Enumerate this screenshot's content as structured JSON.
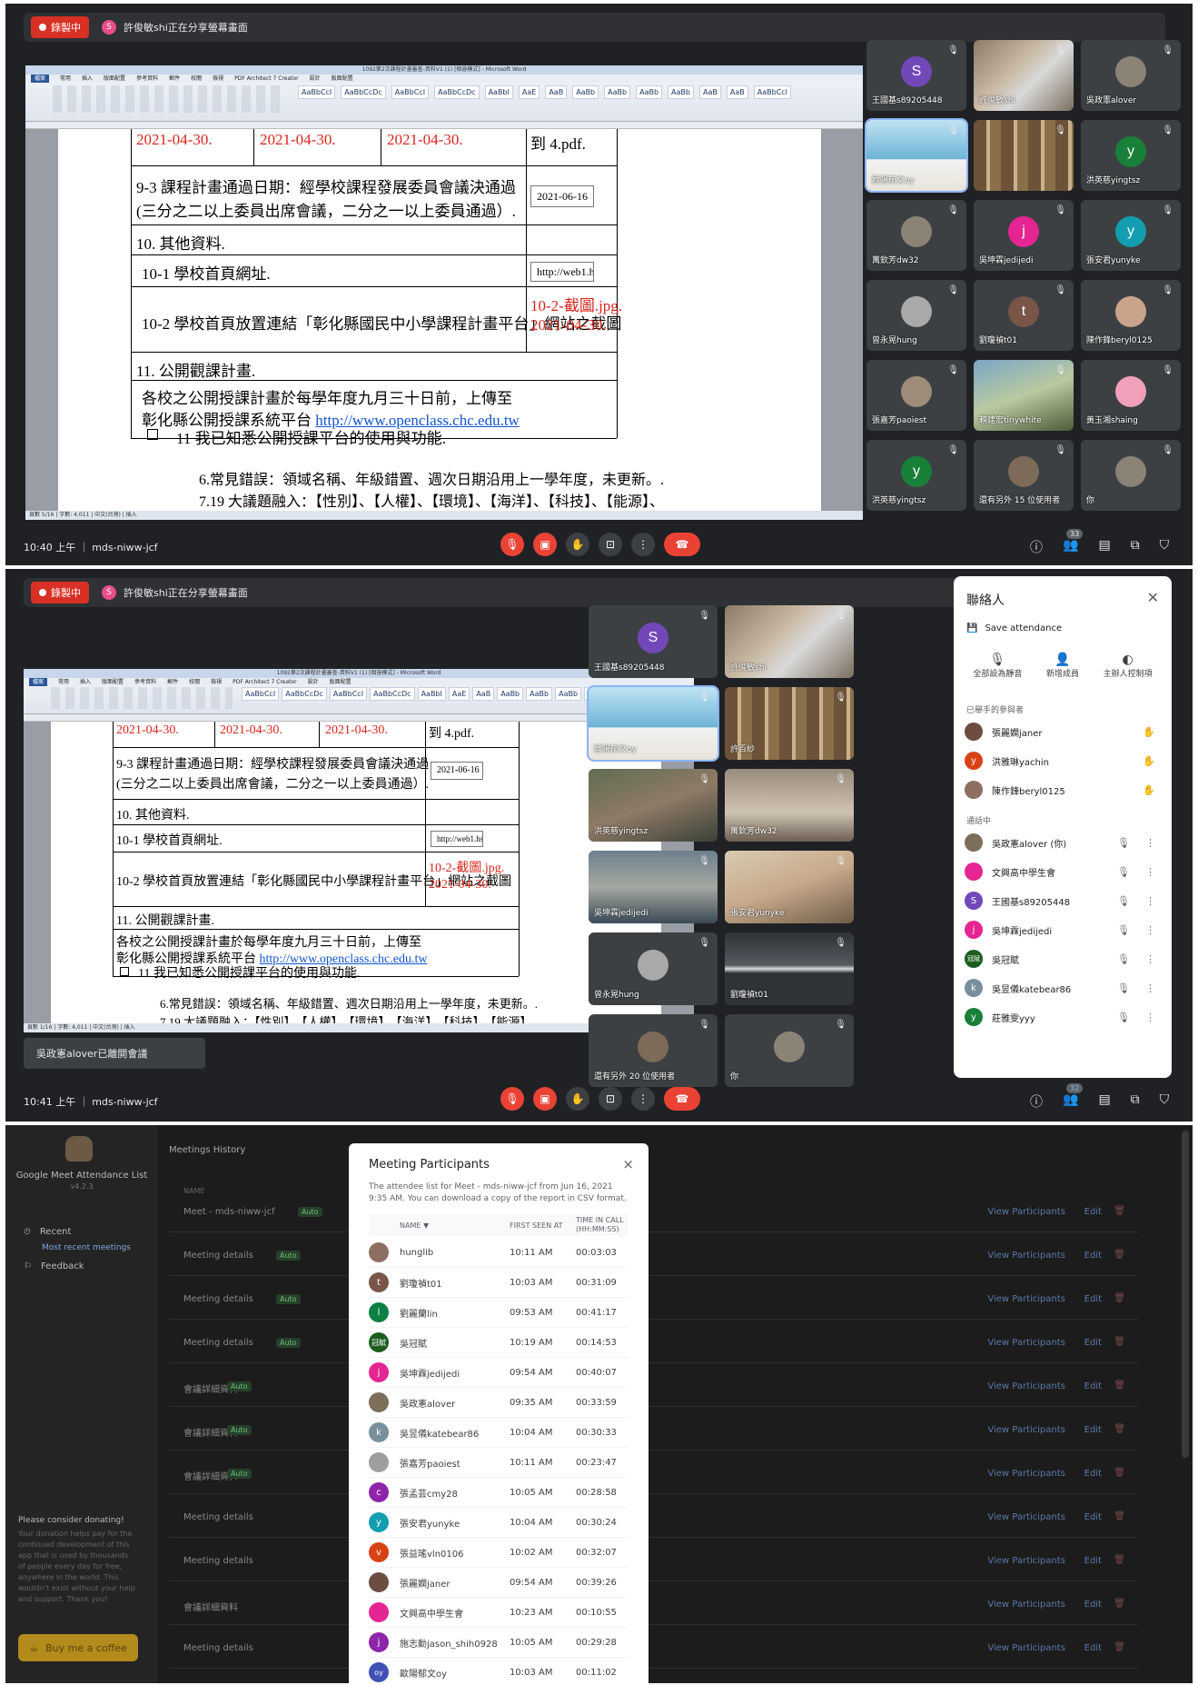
{
  "recording_label": "錄製中",
  "share_initial": "S",
  "share_text": "許俊敏shi正在分享螢幕畫面",
  "doc": {
    "title": "1092第2次課程計畫審查-資料V1 (1) [相容模式] - Microsoft Word",
    "tabs": [
      "檔案",
      "常用",
      "插入",
      "版面配置",
      "參考資料",
      "郵件",
      "校閱",
      "檢視",
      "PDF Architect 7 Creator",
      "設計",
      "版面配置"
    ],
    "styles": [
      "AaBbCcI",
      "AaBbCcDc",
      "AaBbCcI",
      "AaBbCcDc",
      "AaBbI",
      "AaE",
      "AaB",
      "AaBb",
      "AaBb",
      "AaBb",
      "AaBb",
      "AaB",
      "AaB",
      "AaBbCcI"
    ],
    "date1": "2021-04-30.",
    "date2": "2021-04-30.",
    "date3": "2021-04-30.",
    "to_pdf": "到 4.pdf.",
    "row93_line1": "9-3 課程計畫通過日期：經學校課程發展委員會議決通過",
    "row93_line2": "(三分之二以上委員出席會議，二分之一以上委員通過）.",
    "row93_value": "2021-06-16",
    "row10": "10. 其他資料.",
    "row101": "10-1 學校首頁網址.",
    "row101_value": "http://web1.hs",
    "row102": "10-2 學校首頁放置連結「彰化縣國民中小學課程計畫平台」網站之截圖",
    "row102_value1": "10-2-截圖.jpg.",
    "row102_value2": "2021-04-30.",
    "row11": "11. 公開觀課計畫.",
    "row11_line1": "各校之公開授課計畫於每學年度九月三十日前，上傳至",
    "row11_line2_prefix": "彰化縣公開授課系統平台 ",
    "row11_link": "http://www.openclass.chc.edu.tw",
    "row11_check": "11 我已知悉公開授課平台的使用與功能.",
    "note6": "6.常見錯誤：領域名稱、年級錯置、週次日期沿用上一學年度，未更新。.",
    "note7": "7.19 大議題融入：【性別】、【人權】、【環境】、【海洋】、【科技】、【能源】、",
    "status1": "頁數 5/16 | 字數: 4,011 | 中文(台灣) | 插入",
    "status2": "頁數 1/16 | 字數: 4,011 | 中文(台灣) | 插入"
  },
  "panel1": {
    "tiles": [
      {
        "name": "王國基s89205448",
        "initial": "S",
        "color": "#7248b9"
      },
      {
        "name": "許俊敏shi",
        "photo": "man-with-mask"
      },
      {
        "name": "吳政憲alover",
        "photo": "avatar-grey"
      },
      {
        "name": "歐陽郁文oy",
        "photo": "seaside"
      },
      {
        "name": "",
        "photo": "bookshelf"
      },
      {
        "name": "洪英慈yingtsz",
        "initial": "y",
        "color": "#188038"
      },
      {
        "name": "萬欽芳dw32",
        "photo": "avatar-grey"
      },
      {
        "name": "吳坤霖jedijedi",
        "initial": "j",
        "color": "#e52592"
      },
      {
        "name": "張安君yunyke",
        "initial": "y",
        "color": "#129eaf"
      },
      {
        "name": "曾永晃hung",
        "photo": "avatar-sunglasses"
      },
      {
        "name": "劉瓊禎t01",
        "initial": "t",
        "color": "#795548"
      },
      {
        "name": "陳作鋒beryl0125",
        "photo": "avatar-baby"
      },
      {
        "name": "張嘉芳paoiest",
        "photo": "avatar-dog"
      },
      {
        "name": "賴建宏tinywhite",
        "photo": "man-outdoor"
      },
      {
        "name": "黃玉湘shaing",
        "photo": "avatar-girl"
      },
      {
        "name": "洪英慈yingtsz",
        "initial": "y",
        "color": "#188038"
      },
      {
        "name": "還有另外 15 位使用者",
        "photo": "group"
      },
      {
        "name": "你",
        "photo": "avatar-grey"
      }
    ],
    "clock": "10:40 上午 ｜ mds-niww-jcf",
    "people_count": "33"
  },
  "panel2": {
    "tiles": [
      {
        "name": "王國基s89205448",
        "initial": "S",
        "color": "#7248b9"
      },
      {
        "name": "許俊敏shi",
        "photo": "man-with-mask"
      },
      {
        "name": "歐陽郁文oy",
        "photo": "seaside"
      },
      {
        "name": "許百紗",
        "photo": "bookshelf"
      },
      {
        "name": "洪英慈yingtsz",
        "photo": "woman-mask"
      },
      {
        "name": "萬欽芳dw32",
        "photo": "man-door"
      },
      {
        "name": "吳坤霖jedijedi",
        "photo": "man-office"
      },
      {
        "name": "張安君yunyke",
        "photo": "woman-glasses"
      },
      {
        "name": "曾永晃hung",
        "photo": "avatar-sunglasses"
      },
      {
        "name": "劉瓊禎t01",
        "photo": "light"
      },
      {
        "name": "還有另外 20 位使用者",
        "photo": "group"
      },
      {
        "name": "你",
        "photo": "avatar-grey"
      }
    ],
    "toast": "吳政憲alover已離開會議",
    "clock": "10:41 上午 ｜ mds-niww-jcf",
    "people_count": "32",
    "people_panel": {
      "title": "聯絡人",
      "save": "Save attendance",
      "actions": [
        "全部設為靜音",
        "新增成員",
        "主辦人控制項"
      ],
      "raised_header": "已舉手的參與者",
      "raised": [
        {
          "name": "張麗嫻janer",
          "color": "#6d4c41",
          "initial": ""
        },
        {
          "name": "洪雅琳yachin",
          "color": "#d84315",
          "initial": "y"
        },
        {
          "name": "陳作鋒beryl0125",
          "color": "#8d6e63",
          "initial": ""
        }
      ],
      "in_call_header": "通話中",
      "in_call": [
        {
          "name": "吳政憲alover (你)",
          "color": "#7b6f5a",
          "initial": ""
        },
        {
          "name": "文興高中學生會",
          "color": "#e52592",
          "initial": ""
        },
        {
          "name": "王國基s89205448",
          "color": "#7248b9",
          "initial": "S"
        },
        {
          "name": "吳坤霖jedijedi",
          "color": "#e52592",
          "initial": "j"
        },
        {
          "name": "吳冠賦",
          "color": "#1b5e20",
          "initial": "冠賦"
        },
        {
          "name": "吳昱儀katebear86",
          "color": "#78909c",
          "initial": "k"
        },
        {
          "name": "莊雅雯yyy",
          "color": "#188038",
          "initial": "y"
        }
      ]
    }
  },
  "panel3": {
    "app_title": "Google Meet Attendance List",
    "version": "v4.2.3",
    "recent": "Recent",
    "most_recent": "Most recent meetings",
    "feedback": "Feedback",
    "donate_title": "Please consider donating!",
    "donate_text": "Your donation helps pay for the continued development of this app that is used by thousands of people every day for free, anywhere in the world. This wouldn't exist without your help and support. Thank you!",
    "coffee": "Buy me a coffee",
    "history_title": "Meetings History",
    "name_header": "NAME",
    "meetings": [
      {
        "name": "Meet - mds-niww-jcf",
        "tag": "Auto"
      },
      {
        "name": "Meeting details",
        "tag": "Auto"
      },
      {
        "name": "Meeting details",
        "tag": "Auto"
      },
      {
        "name": "Meeting details",
        "tag": "Auto"
      },
      {
        "name": "會議詳細資料",
        "tag": "Auto"
      },
      {
        "name": "會議詳細資料",
        "tag": "Auto"
      },
      {
        "name": "會議詳細資料",
        "tag": "Auto"
      },
      {
        "name": "Meeting details",
        "tag": ""
      },
      {
        "name": "Meeting details",
        "tag": ""
      },
      {
        "name": "會議詳細資料",
        "tag": ""
      },
      {
        "name": "Meeting details",
        "tag": ""
      }
    ],
    "view_label": "View Participants",
    "edit_label": "Edit",
    "modal": {
      "title": "Meeting Participants",
      "close": "×",
      "desc": "The attendee list for Meet - mds-niww-jcf from Jun 16, 2021 9:35 AM. You can download a copy of the report in CSV format.",
      "col1": "NAME ▼",
      "col2": "FIRST SEEN AT",
      "col3": "TIME IN CALL (HH:MM:SS)",
      "rows": [
        {
          "name": "hunglib",
          "seen": "10:11 AM",
          "time": "00:03:03",
          "initial": "",
          "color": "#8d6e63"
        },
        {
          "name": "劉瓊禎t01",
          "seen": "10:03 AM",
          "time": "00:31:09",
          "initial": "t",
          "color": "#795548"
        },
        {
          "name": "劉麗蘭lin",
          "seen": "09:53 AM",
          "time": "00:41:17",
          "initial": "l",
          "color": "#0b8043"
        },
        {
          "name": "吳冠賦",
          "seen": "10:19 AM",
          "time": "00:14:53",
          "initial": "冠賦",
          "color": "#1b5e20"
        },
        {
          "name": "吳坤霖jedijedi",
          "seen": "09:54 AM",
          "time": "00:40:07",
          "initial": "j",
          "color": "#e52592"
        },
        {
          "name": "吳政憲alover",
          "seen": "09:35 AM",
          "time": "00:33:59",
          "initial": "",
          "color": "#7b6f5a"
        },
        {
          "name": "吳昱儀katebear86",
          "seen": "10:04 AM",
          "time": "00:30:33",
          "initial": "k",
          "color": "#78909c"
        },
        {
          "name": "張嘉芳paoiest",
          "seen": "10:11 AM",
          "time": "00:23:47",
          "initial": "",
          "color": "#9e9e9e"
        },
        {
          "name": "張孟芸cmy28",
          "seen": "10:05 AM",
          "time": "00:28:58",
          "initial": "c",
          "color": "#8e24aa"
        },
        {
          "name": "張安君yunyke",
          "seen": "10:04 AM",
          "time": "00:30:24",
          "initial": "y",
          "color": "#129eaf"
        },
        {
          "name": "張益瑤vln0106",
          "seen": "10:02 AM",
          "time": "00:32:07",
          "initial": "v",
          "color": "#d84315"
        },
        {
          "name": "張麗嫻janer",
          "seen": "09:54 AM",
          "time": "00:39:26",
          "initial": "",
          "color": "#6d4c41"
        },
        {
          "name": "文興高中學生會",
          "seen": "10:23 AM",
          "time": "00:10:55",
          "initial": "",
          "color": "#e52592"
        },
        {
          "name": "施志勳jason_shih0928",
          "seen": "10:05 AM",
          "time": "00:29:28",
          "initial": "j",
          "color": "#8e24aa"
        },
        {
          "name": "歐陽郁文oy",
          "seen": "10:03 AM",
          "time": "00:11:02",
          "initial": "oy",
          "color": "#3f51b5"
        }
      ]
    }
  }
}
